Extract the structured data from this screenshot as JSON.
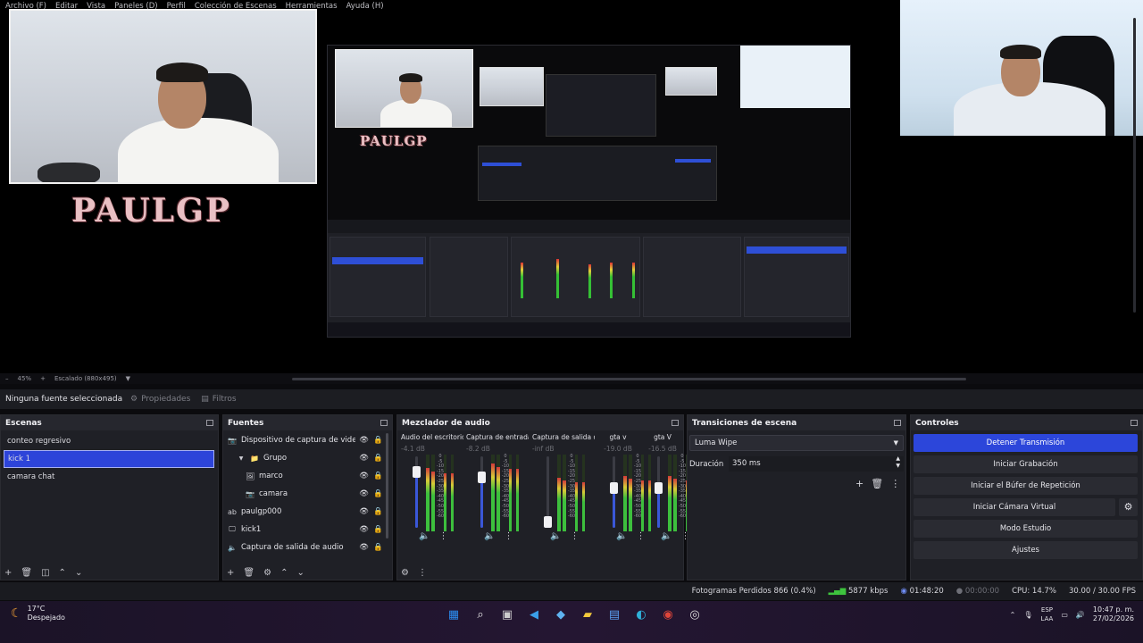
{
  "menu": [
    "Archivo (F)",
    "Editar",
    "Vista",
    "Paneles (D)",
    "Perfil",
    "Colección de Escenas",
    "Herramientas",
    "Ayuda (H)"
  ],
  "preview": {
    "overlay_text_main": "PAULGP",
    "overlay_text_nested": "PAULGP",
    "zoom": "45%",
    "scaling": "Escalado (880x495)"
  },
  "source_toolbar": {
    "no_source": "Ninguna fuente seleccionada",
    "properties": "Propiedades",
    "filters": "Filtros"
  },
  "scenes": {
    "title": "Escenas",
    "items": [
      "conteo regresivo",
      "kick 1",
      "camara chat"
    ],
    "selected": "kick 1"
  },
  "sources": {
    "title": "Fuentes",
    "items": [
      {
        "icon": "camera-icon",
        "label": "Dispositivo de captura de video",
        "indent": 0
      },
      {
        "icon": "folder-icon",
        "label": "Grupo",
        "indent": 1
      },
      {
        "icon": "image-icon",
        "label": "marco",
        "indent": 2
      },
      {
        "icon": "camera-icon",
        "label": "camara",
        "indent": 2
      },
      {
        "icon": "text-icon",
        "label": "paulgp000",
        "indent": 0
      },
      {
        "icon": "monitor-icon",
        "label": "kick1",
        "indent": 0
      },
      {
        "icon": "speaker-icon",
        "label": "Captura de salida de audio",
        "indent": 0
      }
    ]
  },
  "mixer": {
    "title": "Mezclador de audio",
    "channels": [
      {
        "name": "Audio del escritorio",
        "db": "-4.1 dB",
        "fader": 0.78,
        "level": 0.82
      },
      {
        "name": "Captura de entrada de audio",
        "db": "-8.2 dB",
        "fader": 0.7,
        "level": 0.88
      },
      {
        "name": "Captura de salida de audio",
        "db": "-inf dB",
        "fader": 0.05,
        "level": 0.7
      },
      {
        "name": "gta v",
        "db": "-19.0 dB",
        "fader": 0.55,
        "level": 0.72
      },
      {
        "name": "gta V",
        "db": "-16.5 dB",
        "fader": 0.55,
        "level": 0.72
      }
    ],
    "scale": [
      "0",
      "-5",
      "-10",
      "-15",
      "-20",
      "-25",
      "-30",
      "-35",
      "-40",
      "-45",
      "-50",
      "-55",
      "-60"
    ]
  },
  "transitions": {
    "title": "Transiciones de escena",
    "selected": "Luma Wipe",
    "duration_label": "Duración",
    "duration_value": "350 ms"
  },
  "controls": {
    "title": "Controles",
    "buttons": [
      "Detener Transmisión",
      "Iniciar Grabación",
      "Iniciar el Búfer de Repetición",
      "Iniciar Cámara Virtual",
      "Modo Estudio",
      "Ajustes"
    ]
  },
  "status": {
    "dropped": "Fotogramas Perdidos 866 (0.4%)",
    "bitrate": "5877 kbps",
    "stream_time": "01:48:20",
    "rec_time": "00:00:00",
    "cpu": "CPU: 14.7%",
    "fps": "30.00 / 30.00 FPS"
  },
  "taskbar": {
    "temp": "17°C",
    "weather": "Despejado",
    "lang_top": "ESP",
    "lang_bottom": "LAA",
    "time": "10:47 p. m.",
    "date": "27/02/2026",
    "colors": {
      "accent": "#2c46da",
      "start": "#2b8cf0"
    }
  }
}
